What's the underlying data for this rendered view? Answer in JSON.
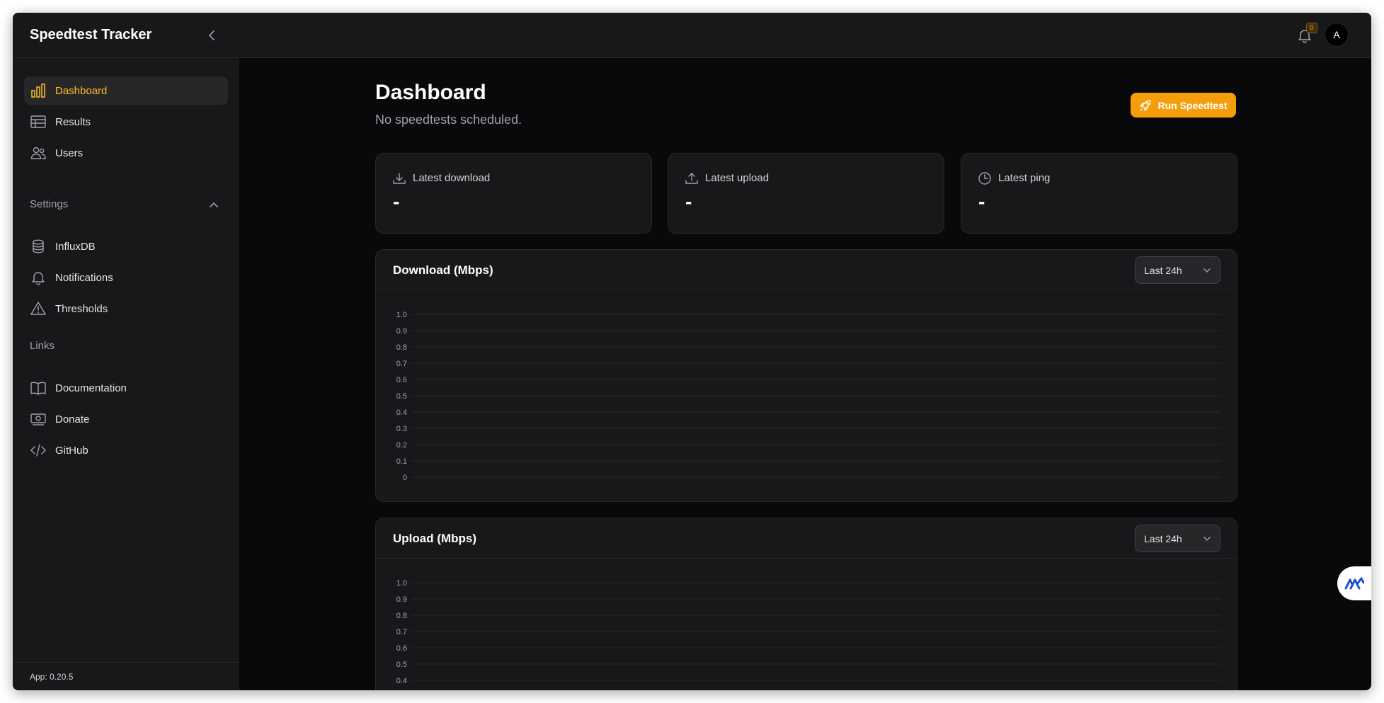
{
  "app": {
    "brand": "Speedtest Tracker",
    "version": "App: 0.20.5"
  },
  "header": {
    "notification_count": "0",
    "avatar_initial": "A"
  },
  "sidebar": {
    "items": [
      {
        "label": "Dashboard",
        "icon": "bar-chart-icon",
        "active": true
      },
      {
        "label": "Results",
        "icon": "table-icon"
      },
      {
        "label": "Users",
        "icon": "users-icon"
      }
    ],
    "settings_label": "Settings",
    "settings_items": [
      {
        "label": "InfluxDB",
        "icon": "database-icon"
      },
      {
        "label": "Notifications",
        "icon": "bell-icon"
      },
      {
        "label": "Thresholds",
        "icon": "warning-triangle-icon"
      }
    ],
    "links_label": "Links",
    "links_items": [
      {
        "label": "Documentation",
        "icon": "book-icon"
      },
      {
        "label": "Donate",
        "icon": "money-icon"
      },
      {
        "label": "GitHub",
        "icon": "code-icon"
      }
    ]
  },
  "page": {
    "title": "Dashboard",
    "subtitle": "No speedtests scheduled.",
    "run_button": "Run Speedtest"
  },
  "stats": [
    {
      "label": "Latest download",
      "value": "-",
      "icon": "download-icon"
    },
    {
      "label": "Latest upload",
      "value": "-",
      "icon": "upload-icon"
    },
    {
      "label": "Latest ping",
      "value": "-",
      "icon": "clock-icon"
    }
  ],
  "charts": {
    "download": {
      "title": "Download (Mbps)",
      "range": "Last 24h"
    },
    "upload": {
      "title": "Upload (Mbps)",
      "range": "Last 24h"
    }
  },
  "colors": {
    "accent": "#f59e0b",
    "background": "#09090b",
    "surface": "#18181b",
    "border": "#27272a"
  },
  "chart_data": [
    {
      "type": "line",
      "title": "Download (Mbps)",
      "yticks": [
        "1.0",
        "0.9",
        "0.8",
        "0.7",
        "0.6",
        "0.5",
        "0.4",
        "0.3",
        "0.2",
        "0.1",
        "0"
      ],
      "ylim": [
        0,
        1.0
      ],
      "series": [],
      "grid": true
    },
    {
      "type": "line",
      "title": "Upload (Mbps)",
      "yticks": [
        "1.0",
        "0.9",
        "0.8",
        "0.7",
        "0.6",
        "0.5",
        "0.4"
      ],
      "ylim": [
        0,
        1.0
      ],
      "series": [],
      "grid": true
    }
  ]
}
